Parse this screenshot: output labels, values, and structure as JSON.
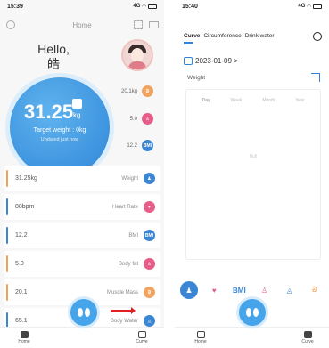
{
  "left": {
    "status": {
      "time": "15:39",
      "network": "4G"
    },
    "header": {
      "title": "Home"
    },
    "greeting": {
      "hello": "Hello,",
      "name": "皓"
    },
    "weight_circle": {
      "value": "31.25",
      "unit": "kg",
      "target": "Target weight : 0kg",
      "updated": "Updated just now"
    },
    "mini": [
      {
        "value": "20.1kg",
        "icon": "muscle-icon",
        "color": "#f0a35e"
      },
      {
        "value": "5.0",
        "icon": "fat-icon",
        "color": "#e85c8a"
      },
      {
        "value": "12.2",
        "icon": "bmi-icon",
        "color": "#3b86d4"
      }
    ],
    "cards": [
      {
        "value": "31.25kg",
        "label": "Weight",
        "bar": "#f0a35e",
        "icon": "weight-icon",
        "icon_text": "",
        "color": "#3b86d4"
      },
      {
        "value": "88bpm",
        "label": "Heart Rate",
        "bar": "#3b86d4",
        "icon": "heart-rate-icon",
        "icon_text": "",
        "color": "#e85c8a"
      },
      {
        "value": "12.2",
        "label": "BMI",
        "bar": "#3b86d4",
        "icon": "bmi-icon",
        "icon_text": "BMI",
        "color": "#3b86d4"
      },
      {
        "value": "5.0",
        "label": "Body fat",
        "bar": "#f0a35e",
        "icon": "body-fat-icon",
        "icon_text": "",
        "color": "#e85c8a"
      },
      {
        "value": "20.1",
        "label": "Muscle Mass",
        "bar": "#f0a35e",
        "icon": "muscle-mass-icon",
        "icon_text": "",
        "color": "#f0a35e"
      },
      {
        "value": "65.1",
        "label": "Body Water",
        "bar": "#3b86d4",
        "icon": "body-water-icon",
        "icon_text": "",
        "color": "#3b86d4"
      }
    ],
    "tabbar": {
      "home": "Home",
      "curve": "Curve"
    }
  },
  "right": {
    "status": {
      "time": "15:40",
      "network": "4G"
    },
    "tabs": [
      "Curve",
      "Circumference",
      "Drink water"
    ],
    "date": "2023-01-09 >",
    "metric_label": "Weight",
    "periods": [
      "Day",
      "Week",
      "Month",
      "Year"
    ],
    "empty": "Null",
    "metrics": [
      "weight-icon",
      "heart-rate-icon",
      "BMI",
      "body-fat-icon",
      "body-water-icon",
      "muscle-mass-icon"
    ],
    "tabbar": {
      "home": "Home",
      "curve": "Curve"
    }
  }
}
